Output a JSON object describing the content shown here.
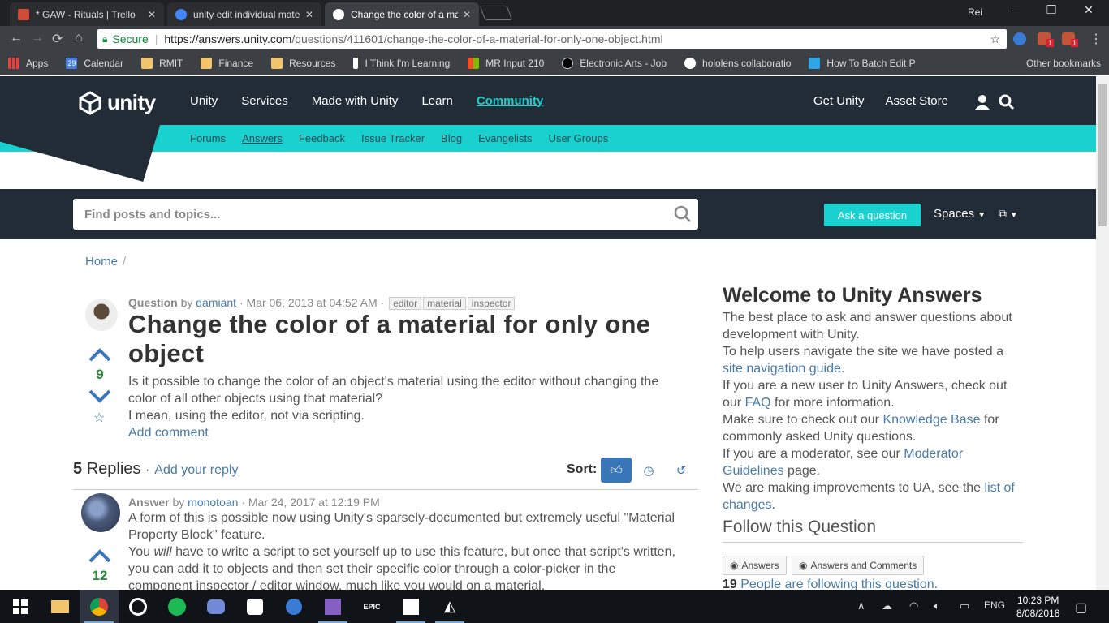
{
  "browser": {
    "tabs": [
      {
        "title": "* GAW - Rituals | Trello",
        "color": "#d24b3a",
        "active": false
      },
      {
        "title": "unity edit individual mate",
        "color": "#4285f4",
        "active": false
      },
      {
        "title": "Change the color of a ma",
        "color": "#ffffff",
        "active": true
      }
    ],
    "user": "Rei",
    "security_label": "Secure",
    "url_host": "https://answers.unity.com",
    "url_path": "/questions/411601/change-the-color-of-a-material-for-only-one-object.html",
    "bookmarks": [
      "Apps",
      "Calendar",
      "RMIT",
      "Finance",
      "Resources",
      "I Think I'm Learning",
      "MR Input 210",
      "Electronic Arts - Job",
      "hololens collaboratio",
      "How To Batch Edit P"
    ],
    "other_bookmarks": "Other bookmarks",
    "badge_1": "1",
    "badge_2": "1",
    "calendar_day": "29"
  },
  "unity": {
    "logo": "unity",
    "main_nav": [
      "Unity",
      "Services",
      "Made with Unity",
      "Learn",
      "Community"
    ],
    "right_nav": [
      "Get Unity",
      "Asset Store"
    ],
    "sub_nav": [
      "Forums",
      "Answers",
      "Feedback",
      "Issue Tracker",
      "Blog",
      "Evangelists",
      "User Groups"
    ],
    "search_placeholder": "Find posts and topics...",
    "ask_button": "Ask a question",
    "spaces": "Spaces",
    "accent": "#19d1cf",
    "dark": "#222c37"
  },
  "breadcrumb": {
    "home": "Home",
    "sep": "/"
  },
  "question": {
    "kind": "Question",
    "by": "by",
    "author": "damiant",
    "date": "· Mar 06, 2013 at 04:52 AM ·",
    "tags": [
      "editor",
      "material",
      "inspector"
    ],
    "title": "Change the color of a material for only one object",
    "votes": "9",
    "body_1": "Is it possible to change the color of an object's material using the editor without changing the color of all other objects using that material?",
    "body_2": "I mean, using the editor, not via scripting.",
    "add_comment": "Add comment"
  },
  "replies": {
    "count": "5",
    "label": "Replies",
    "sep": "·",
    "add_reply": "Add your reply",
    "sort_label": "Sort:"
  },
  "answer": {
    "kind": "Answer",
    "by": "by",
    "author": "monotoan",
    "date": "· Mar 24, 2017 at 12:19 PM",
    "votes": "12",
    "p1": "A form of this is possible now using Unity's sparsely-documented but extremely useful \"Material Property Block\" feature.",
    "p2_a": "You ",
    "p2_em": "will",
    "p2_b": " have to write a script to set yourself up to use this feature, but once that script's written, you can add it to objects and then set their specific color through a color-picker in the component inspector / editor window, much like you would on a material."
  },
  "sidebar": {
    "title": "Welcome to Unity Answers",
    "l1": "The best place to ask and answer questions about development with Unity.",
    "l2_a": "To help users navigate the site we have posted a ",
    "l2_link": "site navigation guide",
    "l2_b": ".",
    "l3_a": "If you are a new user to Unity Answers, check out our ",
    "l3_link": "FAQ",
    "l3_b": " for more information.",
    "l4_a": "Make sure to check out our ",
    "l4_link": "Knowledge Base",
    "l4_b": " for commonly asked Unity questions.",
    "l5_a": "If you are a moderator, see our ",
    "l5_link": "Moderator Guidelines",
    "l5_b": " page.",
    "l6_a": "We are making improvements to UA, see the ",
    "l6_link": "list of changes",
    "l6_b": ".",
    "follow_title": "Follow this Question",
    "follow_answers": "Answers",
    "follow_both": "Answers and Comments",
    "followers_count": "19",
    "followers_text": "People are following this question."
  },
  "taskbar": {
    "lang": "ENG",
    "time": "10:23 PM",
    "date": "8/08/2018",
    "epic": "EPIC"
  }
}
